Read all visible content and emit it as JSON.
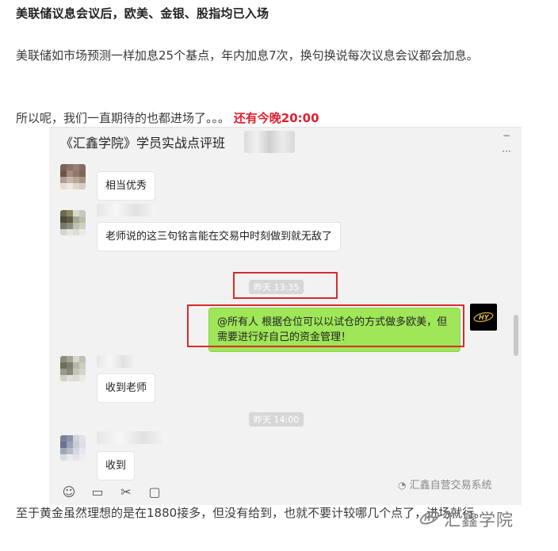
{
  "article": {
    "headline": "美联储议息会议后，欧美、金银、股指均已入场",
    "para1": "美联储如市场预测一样加息25个基点，年内加息7次，换句换说每次议息会议都会加息。",
    "para2_text": "所以呢，我们一直期待的也都进场了。。。",
    "para2_highlight": "还有今晚20:00",
    "para3": "至于黄金虽然理想的是在1880接多，但没有给到，也就不要计较哪几个点了，进场就行。"
  },
  "chat": {
    "title": "《汇鑫学院》学员实战点评班",
    "messages": [
      {
        "text": "相当优秀"
      },
      {
        "text": "老师说的这三句铭言能在交易中时刻做到就无敌了"
      },
      {
        "timestamp": "昨天 13:35"
      },
      {
        "text": "@所有人 根据仓位可以以试仓的方式做多欧美，但需要进行好自己的资金管理！"
      },
      {
        "text": "收到老师"
      },
      {
        "timestamp": "昨天 14:00"
      },
      {
        "text": "收到"
      }
    ],
    "toolbar_icons": [
      "emoji-icon",
      "folder-icon",
      "scissors-icon",
      "chat-bubble-icon"
    ]
  },
  "watermark": {
    "small": "汇鑫自营交易系统",
    "large": "汇鑫学院"
  },
  "colors": {
    "highlight_red": "#e0202e",
    "green_bubble": "#9fe659",
    "annotation_box": "#d92b2b"
  }
}
